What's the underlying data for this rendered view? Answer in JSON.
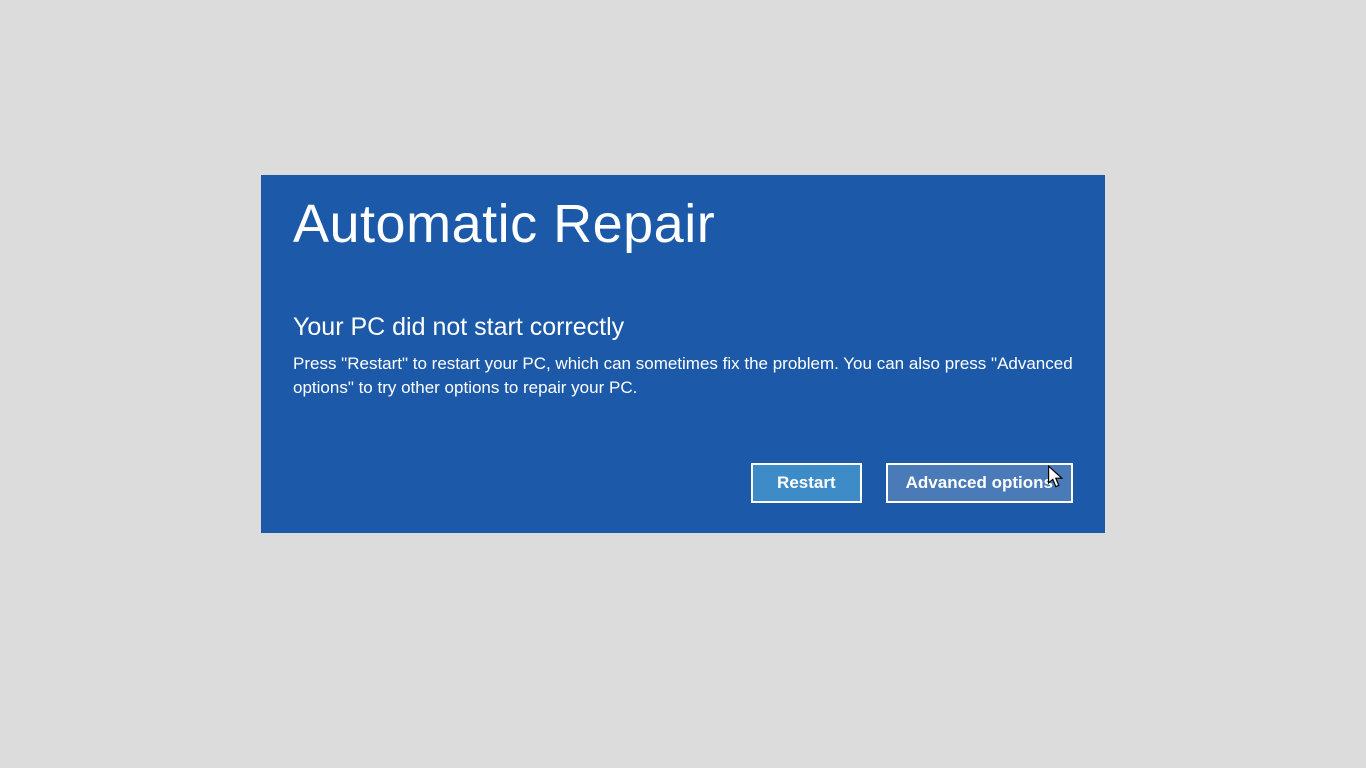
{
  "panel": {
    "title": "Automatic Repair",
    "subtitle": "Your PC did not start correctly",
    "description": "Press \"Restart\" to restart your PC, which can sometimes fix the problem. You can also press \"Advanced options\" to try other options to repair your PC."
  },
  "buttons": {
    "restart_label": "Restart",
    "advanced_label": "Advanced options"
  },
  "colors": {
    "background": "#dcdcdc",
    "panel": "#1c5aa9",
    "button_primary": "#3d8cc8",
    "button_secondary": "#4a7bb8",
    "text": "#ffffff"
  }
}
